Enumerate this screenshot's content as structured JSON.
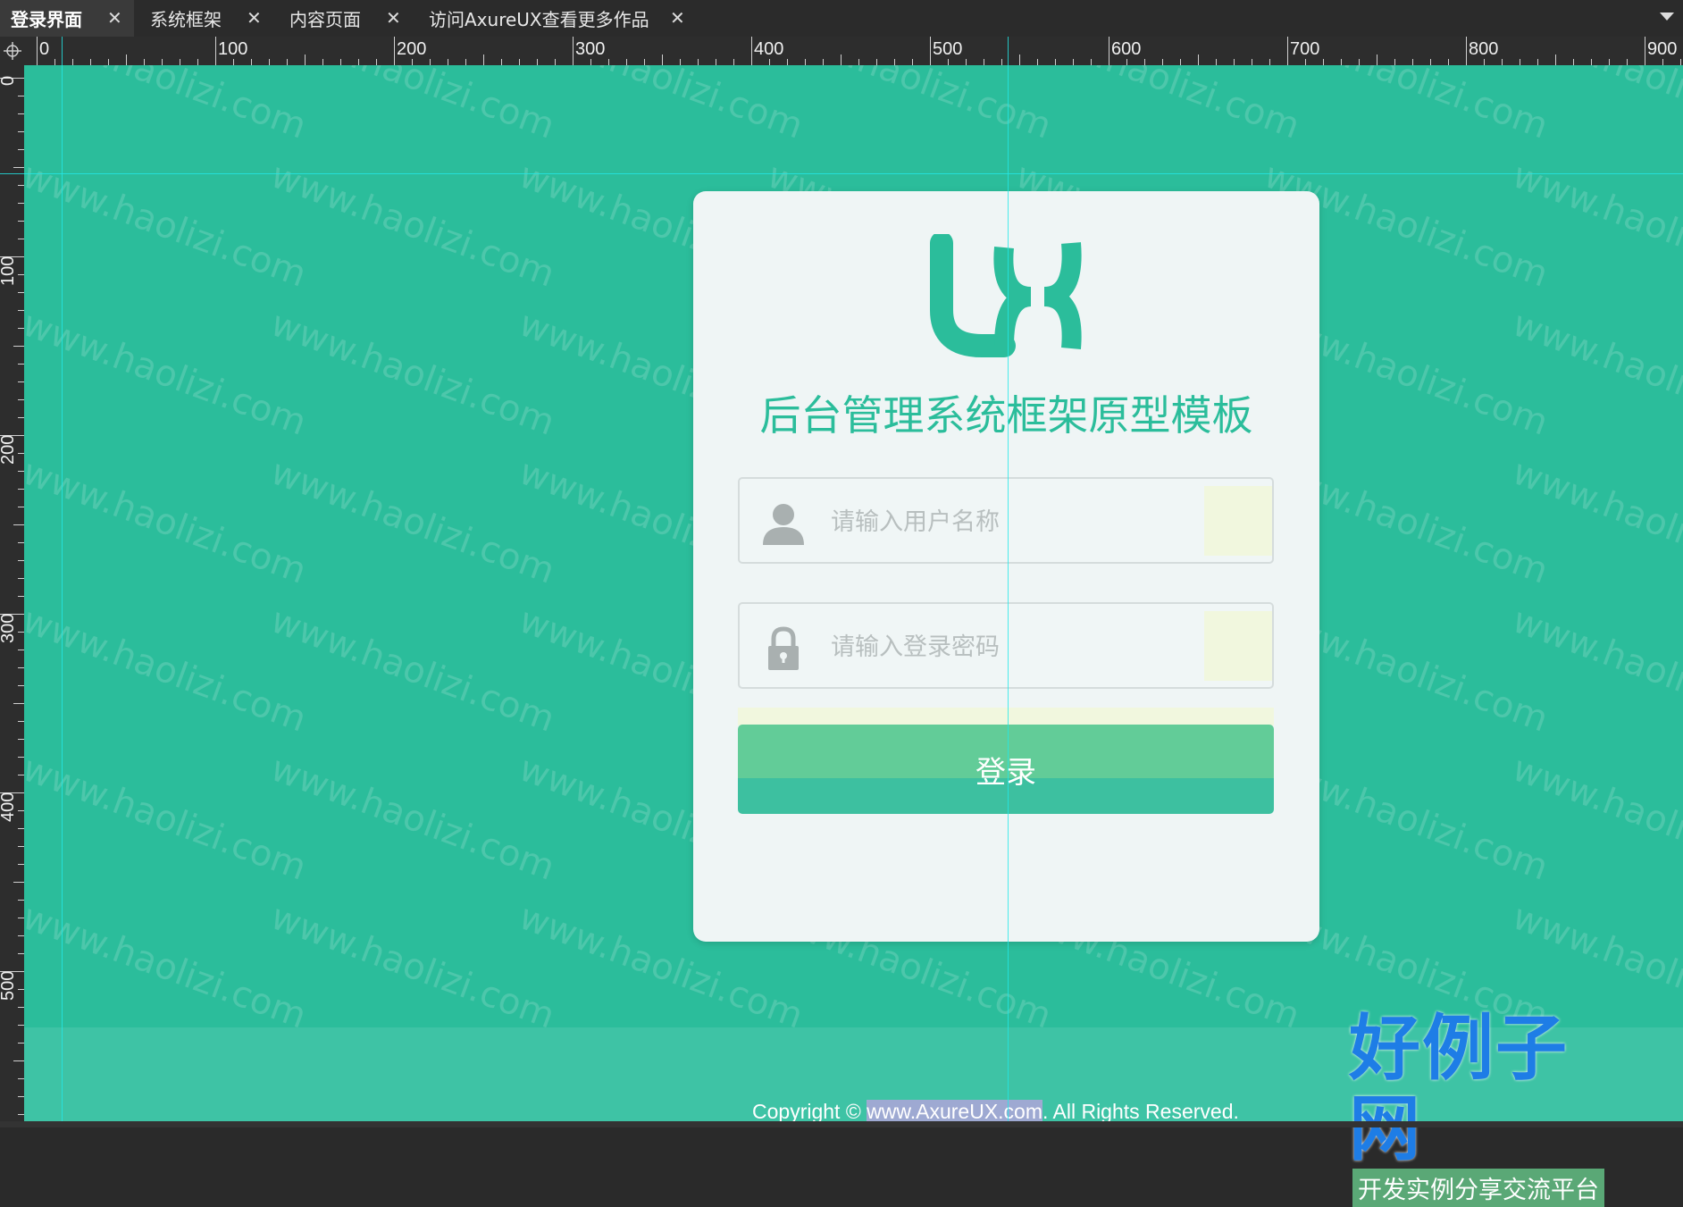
{
  "tabs": [
    {
      "label": "登录界面",
      "active": true
    },
    {
      "label": "系统框架",
      "active": false
    },
    {
      "label": "内容页面",
      "active": false
    },
    {
      "label": "访问AxureUX查看更多作品",
      "active": false
    }
  ],
  "tab_close_glyph": "✕",
  "ruler": {
    "corner_icon": "crosshair-icon",
    "h_labels": [
      "0",
      "100",
      "200",
      "300",
      "400",
      "500",
      "600",
      "700",
      "800",
      "900"
    ],
    "v_labels": [
      "0",
      "100",
      "200",
      "300",
      "400",
      "500"
    ]
  },
  "login": {
    "logo_text": "UX",
    "title": "后台管理系统框架原型模板",
    "username_placeholder": "请输入用户名称",
    "password_placeholder": "请输入登录密码",
    "submit_label": "登录"
  },
  "footer": {
    "copyright_prefix": "Copyright © ",
    "copyright_link": "www.AxureUX.com",
    "copyright_suffix": ". All Rights Reserved."
  },
  "watermark": {
    "text": "www.haolizi.com",
    "brand_name": "好例子网",
    "brand_tagline": "开发实例分享交流平台"
  },
  "colors": {
    "canvas_bg": "#2bbd9b",
    "accent": "#2bbd9b",
    "card_bg": "#eff5f5",
    "button_top": "#62cc98",
    "button_bottom": "#3dc0a0",
    "guide": "#22e8e8"
  }
}
